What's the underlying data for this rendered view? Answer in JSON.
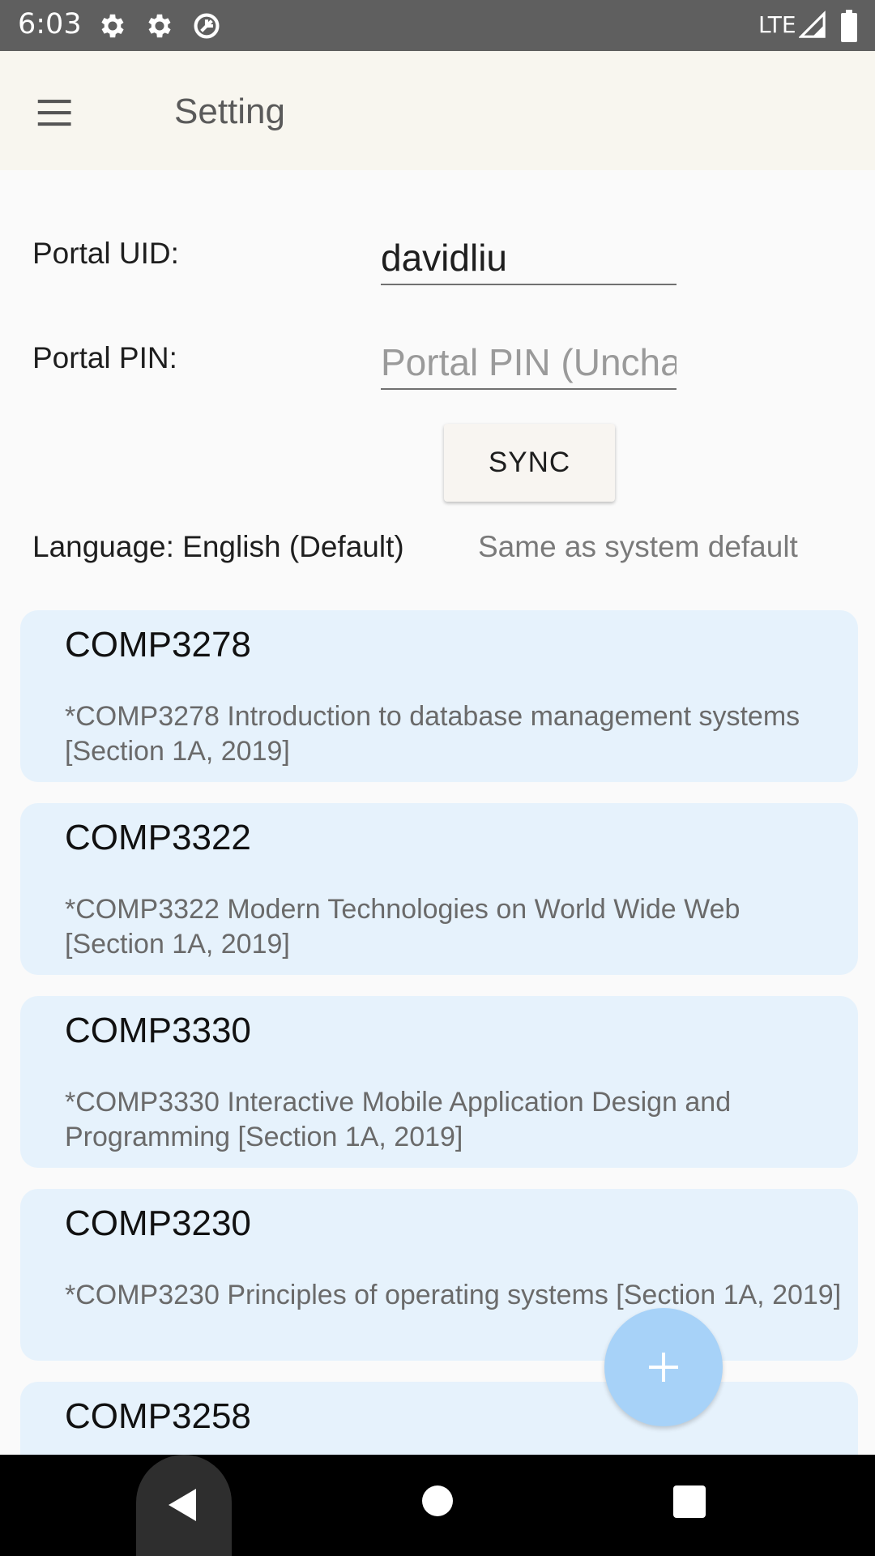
{
  "status_bar": {
    "time": "6:03",
    "icons": [
      "settings-gear-icon",
      "settings-gear-icon",
      "data-saver-icon"
    ],
    "network": "LTE",
    "signal_icon": "signal-icon",
    "battery_icon": "battery-icon",
    "background": "#5f5f5f"
  },
  "app_bar": {
    "menu_icon": "menu-icon",
    "title": "Setting",
    "background": "#f8f6ef"
  },
  "form": {
    "uid_label": "Portal UID:",
    "uid_value": "davidliu",
    "pin_label": "Portal PIN:",
    "pin_placeholder": "Portal PIN (Uncha",
    "sync_label": "SYNC",
    "language_label": "Language: English (Default)",
    "language_value": "Same as system default"
  },
  "courses": [
    {
      "code": "COMP3278",
      "description": "*COMP3278 Introduction to database management systems [Section 1A, 2019]"
    },
    {
      "code": "COMP3322",
      "description": "*COMP3322 Modern Technologies on World Wide Web [Section 1A, 2019]"
    },
    {
      "code": "COMP3330",
      "description": "*COMP3330 Interactive Mobile Application Design and Programming [Section 1A, 2019]"
    },
    {
      "code": "COMP3230",
      "description": "*COMP3230 Principles of operating systems [Section 1A, 2019]"
    },
    {
      "code": "COMP3258",
      "description": ""
    }
  ],
  "fab": {
    "icon": "plus-icon",
    "color": "#a7d2f8"
  },
  "nav_bar": {
    "back_icon": "back-icon",
    "home_icon": "home-icon",
    "recents_icon": "recents-icon"
  },
  "colors": {
    "card_background": "#e6f2fc",
    "page_background": "#fafafa"
  }
}
